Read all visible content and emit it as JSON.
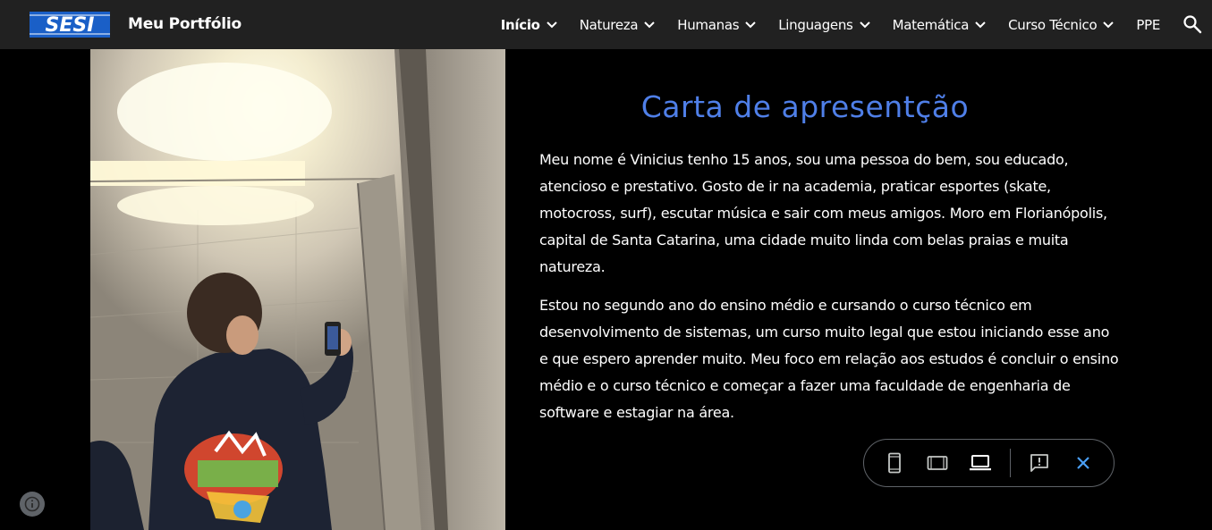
{
  "header": {
    "logo_text": "SESI",
    "site_title": "Meu Portfólio",
    "nav": [
      {
        "label": "Início",
        "active": true,
        "dropdown": true
      },
      {
        "label": "Natureza",
        "active": false,
        "dropdown": true
      },
      {
        "label": "Humanas",
        "active": false,
        "dropdown": true
      },
      {
        "label": "Linguagens",
        "active": false,
        "dropdown": true
      },
      {
        "label": "Matemática",
        "active": false,
        "dropdown": true
      },
      {
        "label": "Curso Técnico",
        "active": false,
        "dropdown": true
      },
      {
        "label": "PPE",
        "active": false,
        "dropdown": false
      }
    ],
    "search_icon": "search-icon"
  },
  "main": {
    "heading": "Carta de apresentção",
    "paragraphs": [
      " Meu nome é Vinicius tenho 15 anos, sou uma pessoa do bem, sou educado, atencioso e prestativo. Gosto de ir na academia, praticar esportes (skate, motocross, surf), escutar música e sair com meus amigos. Moro em Florianópolis, capital de Santa Catarina, uma cidade muito linda com belas praias e muita natureza.",
      " Estou no segundo ano do ensino médio e cursando o curso técnico em desenvolvimento de sistemas, um curso muito legal que estou iniciando esse ano e que espero aprender muito. Meu foco em relação aos estudos é concluir o ensino médio e o curso técnico e começar a fazer uma faculdade de engenharia de software e estagiar na área."
    ],
    "photo_subject": "mirror-selfie-photo"
  },
  "preview_toolbar": {
    "buttons": [
      "phone-view-icon",
      "tablet-view-icon",
      "laptop-view-icon",
      "report-abuse-icon",
      "close-icon"
    ],
    "active": "laptop-view-icon"
  },
  "colors": {
    "header_bg": "#212121",
    "page_bg": "#000000",
    "heading": "#4f7fe8",
    "logo_blue": "#1a5fc7",
    "close_blue": "#4a9ff5"
  }
}
